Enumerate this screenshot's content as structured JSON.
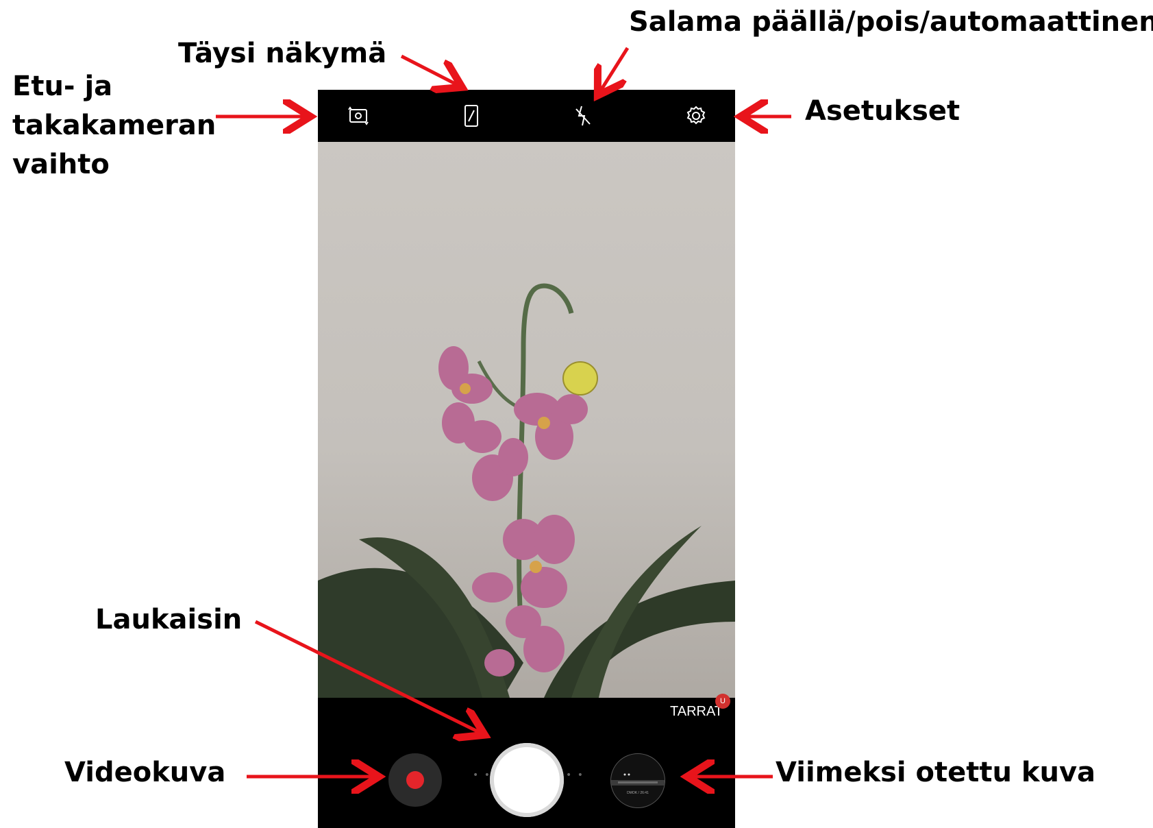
{
  "annotations": {
    "flash": "Salama päällä/pois/automaattinen",
    "full_view": "Täysi näkymä",
    "camera_switch": "Etu- ja\ntakakameran\nvaihto",
    "settings": "Asetukset",
    "shutter": "Laukaisin",
    "video": "Videokuva",
    "last_photo": "Viimeksi otettu kuva"
  },
  "camera_ui": {
    "top_icons": [
      "switch-camera-icon",
      "full-view-icon",
      "flash-off-icon",
      "gear-icon"
    ],
    "stickers_label": "TARRAT",
    "stickers_badge": "U",
    "thumbnail_stamp": "DMOK / 26:41"
  },
  "colors": {
    "arrow": "#e8141b",
    "record_dot": "#e4252b",
    "badge": "#d2312f"
  }
}
